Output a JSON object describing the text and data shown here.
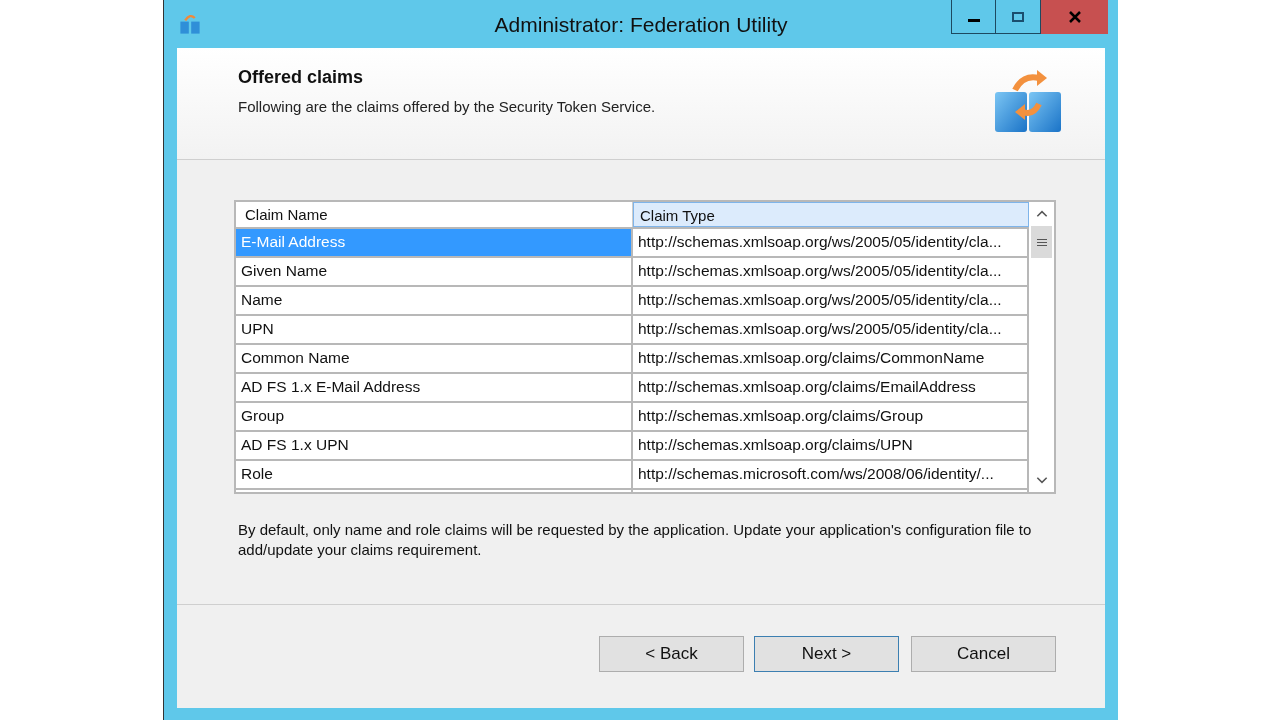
{
  "window": {
    "title": "Administrator: Federation Utility"
  },
  "header": {
    "title": "Offered claims",
    "subtitle": "Following are the claims offered by the Security Token Service."
  },
  "table": {
    "columns": [
      "Claim Name",
      "Claim Type"
    ],
    "rows": [
      {
        "name": "E-Mail Address",
        "type": "http://schemas.xmlsoap.org/ws/2005/05/identity/cla...",
        "selected": true
      },
      {
        "name": "Given Name",
        "type": "http://schemas.xmlsoap.org/ws/2005/05/identity/cla...",
        "selected": false
      },
      {
        "name": "Name",
        "type": "http://schemas.xmlsoap.org/ws/2005/05/identity/cla...",
        "selected": false
      },
      {
        "name": "UPN",
        "type": "http://schemas.xmlsoap.org/ws/2005/05/identity/cla...",
        "selected": false
      },
      {
        "name": "Common Name",
        "type": "http://schemas.xmlsoap.org/claims/CommonName",
        "selected": false
      },
      {
        "name": "AD FS 1.x E-Mail Address",
        "type": "http://schemas.xmlsoap.org/claims/EmailAddress",
        "selected": false
      },
      {
        "name": "Group",
        "type": "http://schemas.xmlsoap.org/claims/Group",
        "selected": false
      },
      {
        "name": "AD FS 1.x UPN",
        "type": "http://schemas.xmlsoap.org/claims/UPN",
        "selected": false
      },
      {
        "name": "Role",
        "type": "http://schemas.microsoft.com/ws/2008/06/identity/...",
        "selected": false
      }
    ]
  },
  "note": "By default, only name and role claims will be requested by the application. Update your application's configuration file to add/update your claims requirement.",
  "buttons": [
    {
      "label": "< Back",
      "default": false
    },
    {
      "label": "Next >",
      "default": true
    },
    {
      "label": "Cancel",
      "default": false
    }
  ]
}
